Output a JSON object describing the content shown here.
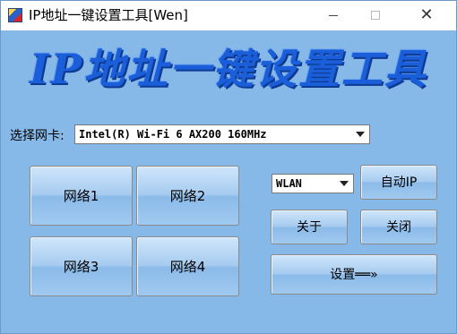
{
  "window": {
    "title": "IP地址一键设置工具[Wen]",
    "close_glyph": "✕"
  },
  "banner": {
    "text": "IP地址一键设置工具"
  },
  "nic": {
    "label": "选择网卡:",
    "selected": "Intel(R) Wi-Fi 6 AX200 160MHz"
  },
  "network_buttons": {
    "net1": "网络1",
    "net2": "网络2",
    "net3": "网络3",
    "net4": "网络4"
  },
  "interface": {
    "selected": "WLAN"
  },
  "actions": {
    "auto_ip": "自动IP",
    "about": "关于",
    "close": "关闭",
    "settings": "设置══»"
  },
  "colors": {
    "window_bg": "#86b9e8",
    "banner_text": "#1a5fd9"
  },
  "icons": {
    "app": "app-icon",
    "minimize": "minimize-icon",
    "maximize": "maximize-icon",
    "close": "close-icon",
    "dropdown": "chevron-down-icon"
  }
}
